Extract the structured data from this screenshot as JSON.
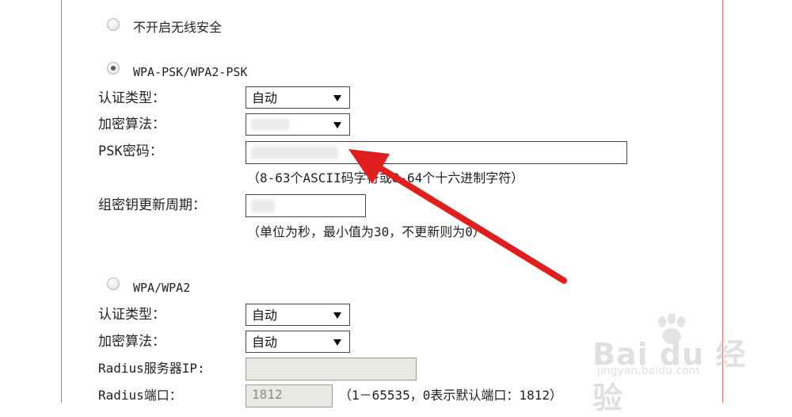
{
  "options": {
    "none": {
      "label": "不开启无线安全",
      "selected": false
    },
    "wpa_psk": {
      "label": "WPA-PSK/WPA2-PSK",
      "selected": true,
      "auth_type_label": "认证类型：",
      "auth_type_value": "自动",
      "encryption_label": "加密算法：",
      "encryption_value": "",
      "psk_label": "PSK密码：",
      "psk_value": "",
      "psk_hint": "（8-63个ASCII码字符或8-64个十六进制字符）",
      "group_key_label": "组密钥更新周期：",
      "group_key_value": "",
      "group_key_hint": "（单位为秒，最小值为30，不更新则为0）"
    },
    "wpa_enterprise": {
      "label": "WPA/WPA2",
      "selected": false,
      "auth_type_label": "认证类型：",
      "auth_type_value": "自动",
      "encryption_label": "加密算法：",
      "encryption_value": "自动",
      "radius_ip_label": "Radius服务器IP:",
      "radius_ip_value": "",
      "radius_port_label": "Radius端口：",
      "radius_port_value": "1812",
      "radius_port_hint": "（1－65535，0表示默认端口：1812）"
    }
  },
  "annotation": {
    "color": "#e01e1e",
    "icon": "red-arrow-pointer"
  },
  "watermark": {
    "logo": "Bai du 经验",
    "url": "jingyan.baidu.com"
  }
}
